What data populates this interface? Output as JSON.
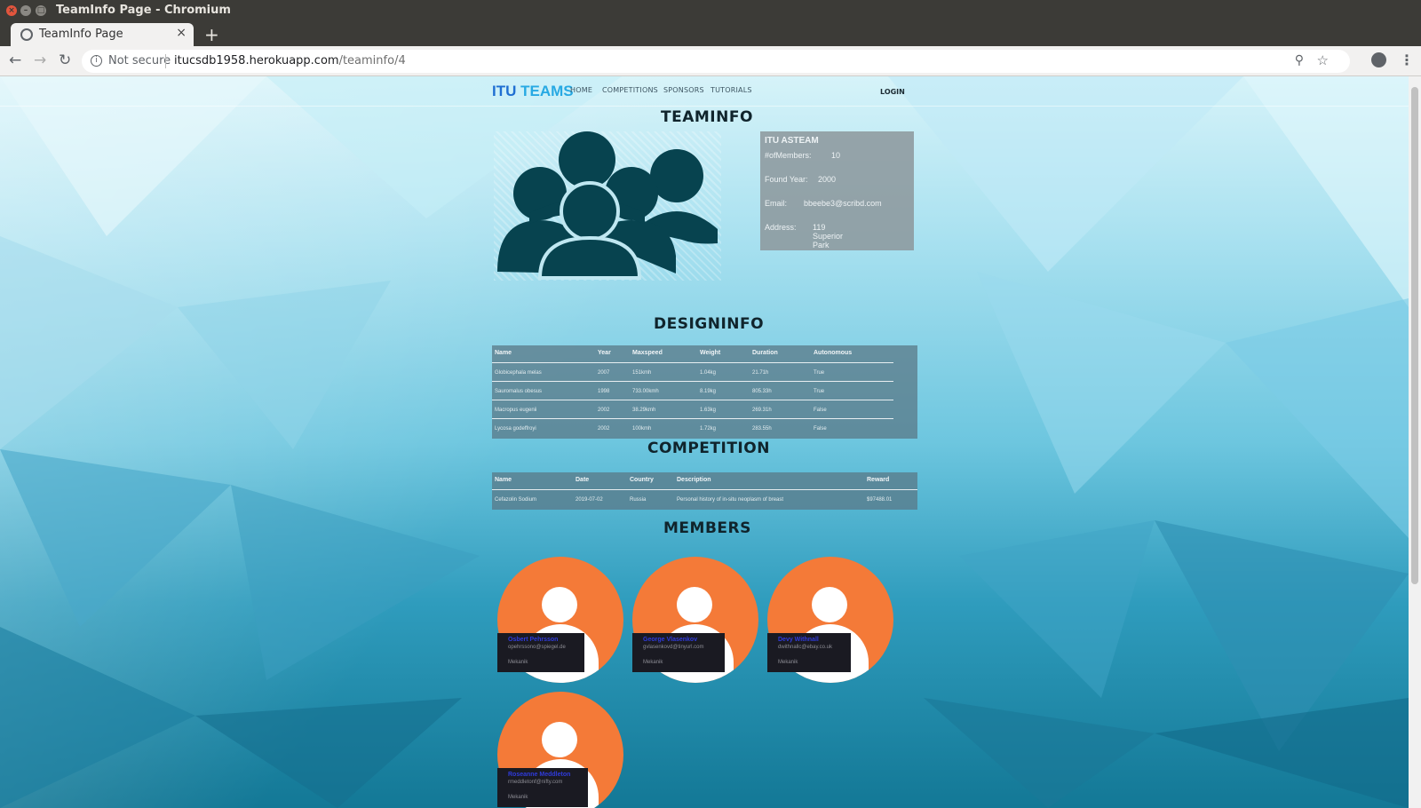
{
  "window": {
    "title": "TeamInfo Page - Chromium"
  },
  "tab": {
    "title": "TeamInfo Page",
    "close": "×",
    "new_tab": "+"
  },
  "address": {
    "security": "Not secure",
    "host": "itucsdb1958.herokuapp.com",
    "path": "/teaminfo/4"
  },
  "site": {
    "brand_1": "ITU ",
    "brand_2": "TEAMS",
    "nav": [
      "HOME",
      "COMPETITIONS",
      "SPONSORS",
      "TUTORIALS"
    ],
    "login": "LOGIN"
  },
  "teaminfo": {
    "title": "TEAMINFO",
    "team_name": "ITU ASTEAM",
    "members_label": "#ofMembers:",
    "members_value": "10",
    "year_label": "Found Year:",
    "year_value": "2000",
    "email_label": "Email:",
    "email_value": "bbeebe3@scribd.com",
    "address_label": "Address:",
    "address_value": "119 Superior Park"
  },
  "designinfo": {
    "title": "DESIGNINFO",
    "headers": [
      "Name",
      "Year",
      "Maxspeed",
      "Weight",
      "Duration",
      "Autonomous"
    ],
    "rows": [
      [
        "Globicephala melas",
        "2007",
        "151kmh",
        "1.04kg",
        "21.71h",
        "True"
      ],
      [
        "Sauromalus obesus",
        "1998",
        "733.00kmh",
        "8.19kg",
        "805.33h",
        "True"
      ],
      [
        "Macropus eugenii",
        "2002",
        "38.29kmh",
        "1.63kg",
        "269.31h",
        "False"
      ],
      [
        "Lycosa godeffroyi",
        "2002",
        "100kmh",
        "1.72kg",
        "283.55h",
        "False"
      ]
    ]
  },
  "competition": {
    "title": "COMPETITION",
    "headers": [
      "Name",
      "Date",
      "Country",
      "Description",
      "Reward"
    ],
    "rows": [
      [
        "Cefazolin Sodium",
        "2019-07-02",
        "Russia",
        "Personal history of in-situ neoplasm of breast",
        "$97488.01"
      ]
    ]
  },
  "members": {
    "title": "MEMBERS",
    "list": [
      {
        "name": "Osbert Pehrsson",
        "email": "opehrssono@spiegel.de",
        "role": "Mekanik"
      },
      {
        "name": "George Vlasenkov",
        "email": "gvlasenkovd@tinyurl.com",
        "role": "Mekanik"
      },
      {
        "name": "Devy Withnall",
        "email": "dwithnallc@ebay.co.uk",
        "role": "Mekanik"
      },
      {
        "name": "Roseanne Meddleton",
        "email": "rmeddletonf@nifty.com",
        "role": "Mekanik"
      }
    ]
  },
  "colors": {
    "accent_orange": "#f47a38",
    "brand_blue": "#1f6fd2",
    "member_name": "#2f3bdc"
  }
}
